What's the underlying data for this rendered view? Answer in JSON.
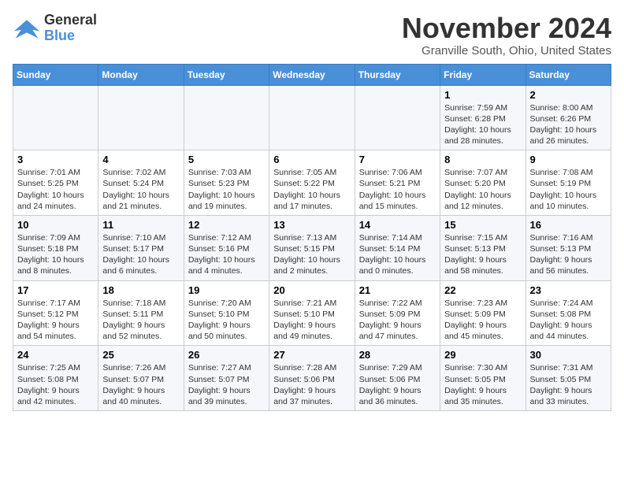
{
  "header": {
    "logo_line1": "General",
    "logo_line2": "Blue",
    "month": "November 2024",
    "location": "Granville South, Ohio, United States"
  },
  "weekdays": [
    "Sunday",
    "Monday",
    "Tuesday",
    "Wednesday",
    "Thursday",
    "Friday",
    "Saturday"
  ],
  "weeks": [
    [
      {
        "num": "",
        "detail": ""
      },
      {
        "num": "",
        "detail": ""
      },
      {
        "num": "",
        "detail": ""
      },
      {
        "num": "",
        "detail": ""
      },
      {
        "num": "",
        "detail": ""
      },
      {
        "num": "1",
        "detail": "Sunrise: 7:59 AM\nSunset: 6:28 PM\nDaylight: 10 hours\nand 28 minutes."
      },
      {
        "num": "2",
        "detail": "Sunrise: 8:00 AM\nSunset: 6:26 PM\nDaylight: 10 hours\nand 26 minutes."
      }
    ],
    [
      {
        "num": "3",
        "detail": "Sunrise: 7:01 AM\nSunset: 5:25 PM\nDaylight: 10 hours\nand 24 minutes."
      },
      {
        "num": "4",
        "detail": "Sunrise: 7:02 AM\nSunset: 5:24 PM\nDaylight: 10 hours\nand 21 minutes."
      },
      {
        "num": "5",
        "detail": "Sunrise: 7:03 AM\nSunset: 5:23 PM\nDaylight: 10 hours\nand 19 minutes."
      },
      {
        "num": "6",
        "detail": "Sunrise: 7:05 AM\nSunset: 5:22 PM\nDaylight: 10 hours\nand 17 minutes."
      },
      {
        "num": "7",
        "detail": "Sunrise: 7:06 AM\nSunset: 5:21 PM\nDaylight: 10 hours\nand 15 minutes."
      },
      {
        "num": "8",
        "detail": "Sunrise: 7:07 AM\nSunset: 5:20 PM\nDaylight: 10 hours\nand 12 minutes."
      },
      {
        "num": "9",
        "detail": "Sunrise: 7:08 AM\nSunset: 5:19 PM\nDaylight: 10 hours\nand 10 minutes."
      }
    ],
    [
      {
        "num": "10",
        "detail": "Sunrise: 7:09 AM\nSunset: 5:18 PM\nDaylight: 10 hours\nand 8 minutes."
      },
      {
        "num": "11",
        "detail": "Sunrise: 7:10 AM\nSunset: 5:17 PM\nDaylight: 10 hours\nand 6 minutes."
      },
      {
        "num": "12",
        "detail": "Sunrise: 7:12 AM\nSunset: 5:16 PM\nDaylight: 10 hours\nand 4 minutes."
      },
      {
        "num": "13",
        "detail": "Sunrise: 7:13 AM\nSunset: 5:15 PM\nDaylight: 10 hours\nand 2 minutes."
      },
      {
        "num": "14",
        "detail": "Sunrise: 7:14 AM\nSunset: 5:14 PM\nDaylight: 10 hours\nand 0 minutes."
      },
      {
        "num": "15",
        "detail": "Sunrise: 7:15 AM\nSunset: 5:13 PM\nDaylight: 9 hours\nand 58 minutes."
      },
      {
        "num": "16",
        "detail": "Sunrise: 7:16 AM\nSunset: 5:13 PM\nDaylight: 9 hours\nand 56 minutes."
      }
    ],
    [
      {
        "num": "17",
        "detail": "Sunrise: 7:17 AM\nSunset: 5:12 PM\nDaylight: 9 hours\nand 54 minutes."
      },
      {
        "num": "18",
        "detail": "Sunrise: 7:18 AM\nSunset: 5:11 PM\nDaylight: 9 hours\nand 52 minutes."
      },
      {
        "num": "19",
        "detail": "Sunrise: 7:20 AM\nSunset: 5:10 PM\nDaylight: 9 hours\nand 50 minutes."
      },
      {
        "num": "20",
        "detail": "Sunrise: 7:21 AM\nSunset: 5:10 PM\nDaylight: 9 hours\nand 49 minutes."
      },
      {
        "num": "21",
        "detail": "Sunrise: 7:22 AM\nSunset: 5:09 PM\nDaylight: 9 hours\nand 47 minutes."
      },
      {
        "num": "22",
        "detail": "Sunrise: 7:23 AM\nSunset: 5:09 PM\nDaylight: 9 hours\nand 45 minutes."
      },
      {
        "num": "23",
        "detail": "Sunrise: 7:24 AM\nSunset: 5:08 PM\nDaylight: 9 hours\nand 44 minutes."
      }
    ],
    [
      {
        "num": "24",
        "detail": "Sunrise: 7:25 AM\nSunset: 5:08 PM\nDaylight: 9 hours\nand 42 minutes."
      },
      {
        "num": "25",
        "detail": "Sunrise: 7:26 AM\nSunset: 5:07 PM\nDaylight: 9 hours\nand 40 minutes."
      },
      {
        "num": "26",
        "detail": "Sunrise: 7:27 AM\nSunset: 5:07 PM\nDaylight: 9 hours\nand 39 minutes."
      },
      {
        "num": "27",
        "detail": "Sunrise: 7:28 AM\nSunset: 5:06 PM\nDaylight: 9 hours\nand 37 minutes."
      },
      {
        "num": "28",
        "detail": "Sunrise: 7:29 AM\nSunset: 5:06 PM\nDaylight: 9 hours\nand 36 minutes."
      },
      {
        "num": "29",
        "detail": "Sunrise: 7:30 AM\nSunset: 5:05 PM\nDaylight: 9 hours\nand 35 minutes."
      },
      {
        "num": "30",
        "detail": "Sunrise: 7:31 AM\nSunset: 5:05 PM\nDaylight: 9 hours\nand 33 minutes."
      }
    ]
  ]
}
